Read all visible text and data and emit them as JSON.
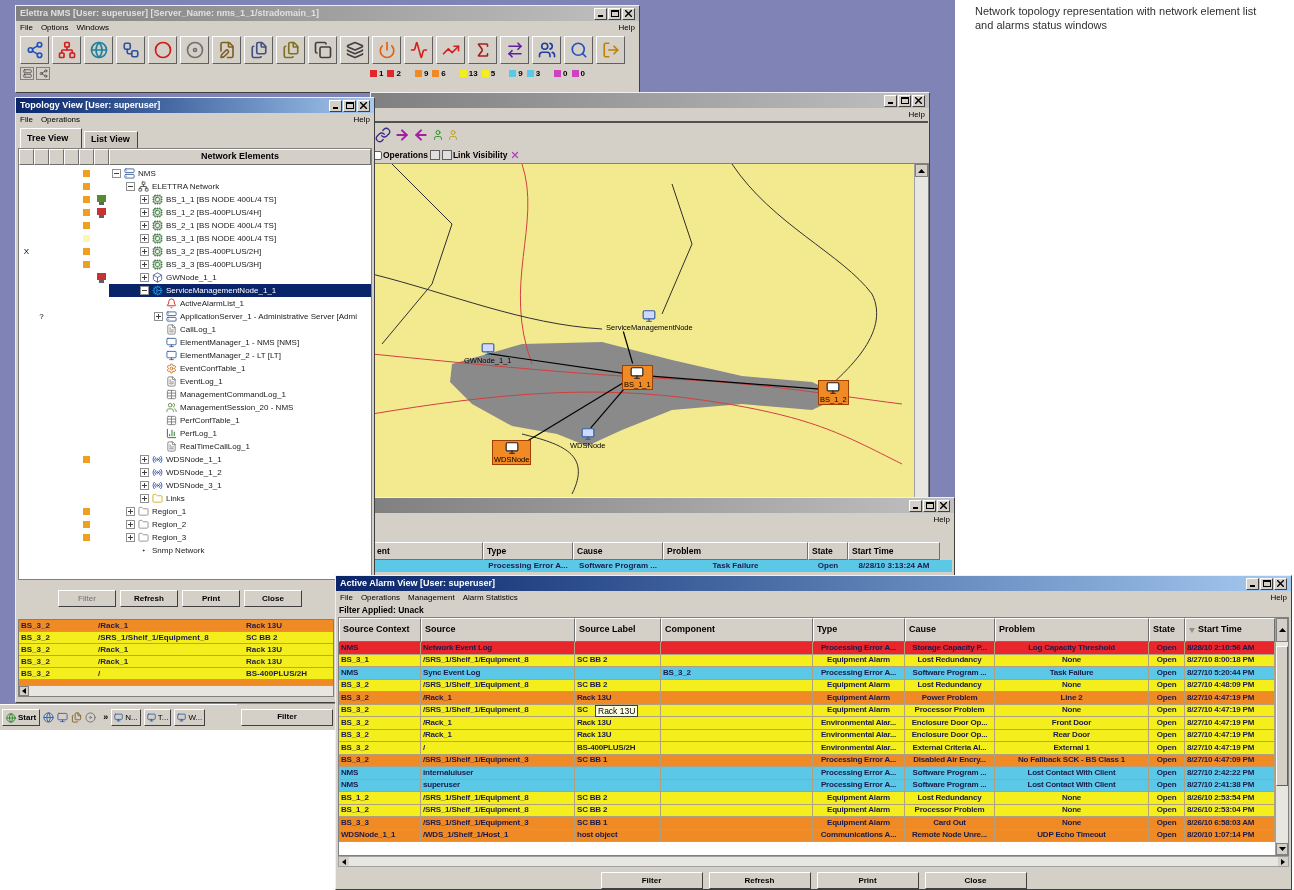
{
  "caption": "Network topology representation with network element list and alarms status windows",
  "main_window": {
    "title": "Elettra NMS [User: superuser] [Server_Name: nms_1_1/stradomain_1]",
    "active": false,
    "menu": [
      "File",
      "Options",
      "Windows"
    ],
    "help": "Help",
    "counters": [
      {
        "color": "#e02828",
        "count": "1"
      },
      {
        "color": "#e02828",
        "count": "2"
      },
      {
        "color": "#f08a24",
        "count": "9"
      },
      {
        "color": "#f08a24",
        "count": "6"
      },
      {
        "color": "#f4ef1c",
        "count": "13"
      },
      {
        "color": "#f4ef1c",
        "count": "5"
      },
      {
        "color": "#5cc8e8",
        "count": "9"
      },
      {
        "color": "#5cc8e8",
        "count": "3"
      },
      {
        "color": "#d040c0",
        "count": "0"
      },
      {
        "color": "#d040c0",
        "count": "0"
      }
    ]
  },
  "map_window": {
    "active": false,
    "help": "Help",
    "operations": {
      "label": "Operations",
      "checked": false
    },
    "link_visibility": "Link Visibility",
    "nodes": [
      {
        "label": "ServiceManagementNode",
        "alarm": false
      },
      {
        "label": "GWNode_1_1",
        "alarm": false
      },
      {
        "label": "BS_1_1",
        "alarm": true
      },
      {
        "label": "BS_1_2",
        "alarm": true
      },
      {
        "label": "WDSNode",
        "alarm": true
      },
      {
        "label": "WDSNode",
        "alarm": false
      }
    ]
  },
  "back_alarm_window": {
    "active": false,
    "help": "Help",
    "columns": [
      "ent",
      "Type",
      "Cause",
      "Problem",
      "State",
      "Start Time"
    ],
    "row": {
      "color": "#5cc8e8",
      "cells": [
        "",
        "Processing Error A...",
        "Software Program ...",
        "Task Failure",
        "Open",
        "8/28/10 3:13:24 AM"
      ]
    }
  },
  "topology_window": {
    "title": "Topology View [User: superuser]",
    "active": true,
    "menu": [
      "File",
      "Operations"
    ],
    "help": "Help",
    "tabs": [
      {
        "label": "Tree View",
        "selected": true
      },
      {
        "label": "List View",
        "selected": false
      }
    ],
    "tree_header": "Network Elements",
    "tree": [
      {
        "label": "NMS",
        "kind": "server",
        "color": "#f0a020",
        "expanded": true,
        "selected": false,
        "children": [
          {
            "label": "ELETTRA Network",
            "kind": "network",
            "color": "#f0a020",
            "expanded": true,
            "selected": false,
            "children": [
              {
                "label": "BS_1_1 [BS NODE 400L/4 TS]",
                "kind": "node",
                "color": "#f0a020",
                "device_alarm": false,
                "expanded": false,
                "selected": false
              },
              {
                "label": "BS_1_2 [BS-400PLUS/4H]",
                "kind": "node",
                "color": "#f0a020",
                "device_alarm": true,
                "expanded": false,
                "selected": false
              },
              {
                "label": "BS_2_1 [BS NODE 400L/4 TS]",
                "kind": "node",
                "color": "#f0a020",
                "expanded": false,
                "selected": false
              },
              {
                "label": "BS_3_1 [BS NODE 400L/4 TS]",
                "kind": "node",
                "color": "#fff4b0",
                "expanded": false,
                "selected": false
              },
              {
                "label": "BS_3_2 [BS-400PLUS/2H]",
                "kind": "node",
                "color": "#f0a020",
                "column_1": "X",
                "expanded": false,
                "selected": false
              },
              {
                "label": "BS_3_3 [BS-400PLUS/3H]",
                "kind": "node",
                "color": "#f0a020",
                "expanded": false,
                "selected": false
              },
              {
                "label": "GWNode_1_1",
                "kind": "gateway",
                "device_alarm": true,
                "expanded": false,
                "selected": false
              },
              {
                "label": "ServiceManagementNode_1_1",
                "kind": "service",
                "expanded": true,
                "selected": true,
                "children": [
                  {
                    "label": "ActiveAlarmList_1",
                    "kind": "alarm",
                    "selected": false
                  },
                  {
                    "label": "ApplicationServer_1 - Administrative Server [Admi",
                    "kind": "server",
                    "column_2": "?",
                    "expanded": false,
                    "selected": false
                  },
                  {
                    "label": "CallLog_1",
                    "kind": "log",
                    "selected": false
                  },
                  {
                    "label": "ElementManager_1 - NMS [NMS]",
                    "kind": "manager",
                    "selected": false
                  },
                  {
                    "label": "ElementManager_2 - LT [LT]",
                    "kind": "manager",
                    "selected": false
                  },
                  {
                    "label": "EventConfTable_1",
                    "kind": "config",
                    "selected": false
                  },
                  {
                    "label": "EventLog_1",
                    "kind": "log",
                    "selected": false
                  },
                  {
                    "label": "ManagementCommandLog_1",
                    "kind": "table",
                    "selected": false
                  },
                  {
                    "label": "ManagementSession_20 - NMS",
                    "kind": "session",
                    "selected": false
                  },
                  {
                    "label": "PerfConfTable_1",
                    "kind": "table",
                    "selected": false
                  },
                  {
                    "label": "PerfLog_1",
                    "kind": "chart",
                    "selected": false
                  },
                  {
                    "label": "RealTimeCallLog_1",
                    "kind": "log",
                    "selected": false
                  }
                ]
              },
              {
                "label": "WDSNode_1_1",
                "kind": "wds",
                "color": "#f0a020",
                "expanded": false,
                "selected": false
              },
              {
                "label": "WDSNode_1_2",
                "kind": "wds",
                "expanded": false,
                "selected": false
              },
              {
                "label": "WDSNode_3_1",
                "kind": "wds",
                "expanded": false,
                "selected": false
              },
              {
                "label": "Links",
                "kind": "folder",
                "expanded": false,
                "selected": false
              }
            ]
          },
          {
            "label": "Region_1",
            "kind": "region",
            "color": "#f0a020",
            "expanded": false,
            "selected": false
          },
          {
            "label": "Region_2",
            "kind": "region",
            "color": "#f0a020",
            "expanded": false,
            "selected": false
          },
          {
            "label": "Region_3",
            "kind": "region",
            "color": "#f0a020",
            "expanded": false,
            "selected": false
          },
          {
            "label": "Snmp Network",
            "kind": "point",
            "selected": false
          }
        ]
      }
    ],
    "buttons": [
      {
        "label": "Filter",
        "disabled": true
      },
      {
        "label": "Refresh",
        "disabled": false
      },
      {
        "label": "Print",
        "disabled": false
      },
      {
        "label": "Close",
        "disabled": false
      }
    ],
    "alarm_rows": [
      {
        "color": "#f08a24",
        "cells": [
          "BS_3_2",
          "/Rack_1",
          "Rack 13U"
        ]
      },
      {
        "color": "#f4ef1c",
        "cells": [
          "BS_3_2",
          "/SRS_1/Shelf_1/Equipment_8",
          "SC BB 2"
        ]
      },
      {
        "color": "#f4ef1c",
        "cells": [
          "BS_3_2",
          "/Rack_1",
          "Rack 13U"
        ]
      },
      {
        "color": "#f4ef1c",
        "cells": [
          "BS_3_2",
          "/Rack_1",
          "Rack 13U"
        ]
      },
      {
        "color": "#f4ef1c",
        "cells": [
          "BS_3_2",
          "/",
          "BS-400PLUS/2H"
        ]
      },
      {
        "color": "#f08a24"
      }
    ]
  },
  "bottom_filter_button": {
    "label": "Filter",
    "disabled": false
  },
  "taskbar": {
    "start": "Start",
    "more": "»",
    "tasks": [
      "N...",
      "T...",
      "W..."
    ]
  },
  "alarm_window": {
    "title": "Active Alarm View [User: superuser]",
    "active": true,
    "menu": [
      "File",
      "Operations",
      "Management",
      "Alarm Statistics"
    ],
    "help": "Help",
    "filter": "Filter Applied: Unack",
    "columns": [
      "Source Context",
      "Source",
      "Source Label",
      "Component",
      "Type",
      "Cause",
      "Problem",
      "State",
      "Start Time"
    ],
    "tooltip": "Rack 13U",
    "rows": [
      {
        "color": "#e8262b",
        "cells": [
          "NMS",
          "Network Event Log",
          "",
          "",
          "Processing Error A...",
          "Storage Capacity P...",
          "Log Capacity Threshold",
          "Open",
          "8/28/10 2:10:56 AM"
        ]
      },
      {
        "color": "#f4ef1c",
        "cells": [
          "BS_3_1",
          "/SRS_1/Shelf_1/Equipment_8",
          "SC BB 2",
          "",
          "Equipment Alarm",
          "Lost Redundancy",
          "None",
          "Open",
          "8/27/10 8:00:18 PM"
        ]
      },
      {
        "color": "#5cc8e8",
        "cells": [
          "NMS",
          "Sync Event Log",
          "",
          "BS_3_2",
          "Processing Error A...",
          "Software Program ...",
          "Task Failure",
          "Open",
          "8/27/10 5:20:44 PM"
        ]
      },
      {
        "color": "#f4ef1c",
        "cells": [
          "BS_3_2",
          "/SRS_1/Shelf_1/Equipment_8",
          "SC BB 2",
          "",
          "Equipment Alarm",
          "Lost Redundancy",
          "None",
          "Open",
          "8/27/10 4:48:09 PM"
        ]
      },
      {
        "color": "#f08a24",
        "cells": [
          "BS_3_2",
          "/Rack_1",
          "Rack 13U",
          "",
          "Equipment Alarm",
          "Power Problem",
          "Line 2",
          "Open",
          "8/27/10 4:47:19 PM"
        ]
      },
      {
        "color": "#f4ef1c",
        "cells": [
          "BS_3_2",
          "/SRS_1/Shelf_1/Equipment_8",
          "SC",
          "",
          "Equipment Alarm",
          "Processor Problem",
          "None",
          "Open",
          "8/27/10 4:47:19 PM"
        ]
      },
      {
        "color": "#f4ef1c",
        "cells": [
          "BS_3_2",
          "/Rack_1",
          "Rack 13U",
          "",
          "Environmental Alar...",
          "Enclosure Door Op...",
          "Front Door",
          "Open",
          "8/27/10 4:47:19 PM"
        ]
      },
      {
        "color": "#f4ef1c",
        "cells": [
          "BS_3_2",
          "/Rack_1",
          "Rack 13U",
          "",
          "Environmental Alar...",
          "Enclosure Door Op...",
          "Rear Door",
          "Open",
          "8/27/10 4:47:19 PM"
        ]
      },
      {
        "color": "#f4ef1c",
        "cells": [
          "BS_3_2",
          "/",
          "BS-400PLUS/2H",
          "",
          "Environmental Alar...",
          "External Criteria Al...",
          "External 1",
          "Open",
          "8/27/10 4:47:19 PM"
        ]
      },
      {
        "color": "#f08a24",
        "cells": [
          "BS_3_2",
          "/SRS_1/Shelf_1/Equipment_3",
          "SC BB 1",
          "",
          "Processing Error A...",
          "Disabled Air Encry...",
          "No Fallback SCK - BS Class 1",
          "Open",
          "8/27/10 4:47:09 PM"
        ]
      },
      {
        "color": "#5cc8e8",
        "cells": [
          "NMS",
          "internaluiuser",
          "",
          "",
          "Processing Error A...",
          "Software Program ...",
          "Lost Contact With Client",
          "Open",
          "8/27/10 2:42:22 PM"
        ]
      },
      {
        "color": "#5cc8e8",
        "cells": [
          "NMS",
          "superuser",
          "",
          "",
          "Processing Error A...",
          "Software Program ...",
          "Lost Contact With Client",
          "Open",
          "8/27/10 2:41:38 PM"
        ]
      },
      {
        "color": "#f4ef1c",
        "cells": [
          "BS_1_2",
          "/SRS_1/Shelf_1/Equipment_8",
          "SC BB 2",
          "",
          "Equipment Alarm",
          "Lost Redundancy",
          "None",
          "Open",
          "8/26/10 2:53:54 PM"
        ]
      },
      {
        "color": "#f4ef1c",
        "cells": [
          "BS_1_2",
          "/SRS_1/Shelf_1/Equipment_8",
          "SC BB 2",
          "",
          "Equipment Alarm",
          "Processor Problem",
          "None",
          "Open",
          "8/26/10 2:53:04 PM"
        ]
      },
      {
        "color": "#f08a24",
        "cells": [
          "BS_3_3",
          "/SRS_1/Shelf_1/Equipment_3",
          "SC BB 1",
          "",
          "Equipment Alarm",
          "Card Out",
          "None",
          "Open",
          "8/26/10 6:58:03 AM"
        ]
      },
      {
        "color": "#f08a24",
        "cells": [
          "WDSNode_1_1",
          "/WDS_1/Shelf_1/Host_1",
          "host object",
          "",
          "Communications A...",
          "Remote Node Unre...",
          "UDP Echo Timeout",
          "Open",
          "8/20/10 1:07:14 PM"
        ]
      }
    ],
    "buttons": [
      {
        "label": "Filter",
        "disabled": false
      },
      {
        "label": "Refresh",
        "disabled": false
      },
      {
        "label": "Print",
        "disabled": false
      },
      {
        "label": "Close",
        "disabled": false
      }
    ]
  }
}
